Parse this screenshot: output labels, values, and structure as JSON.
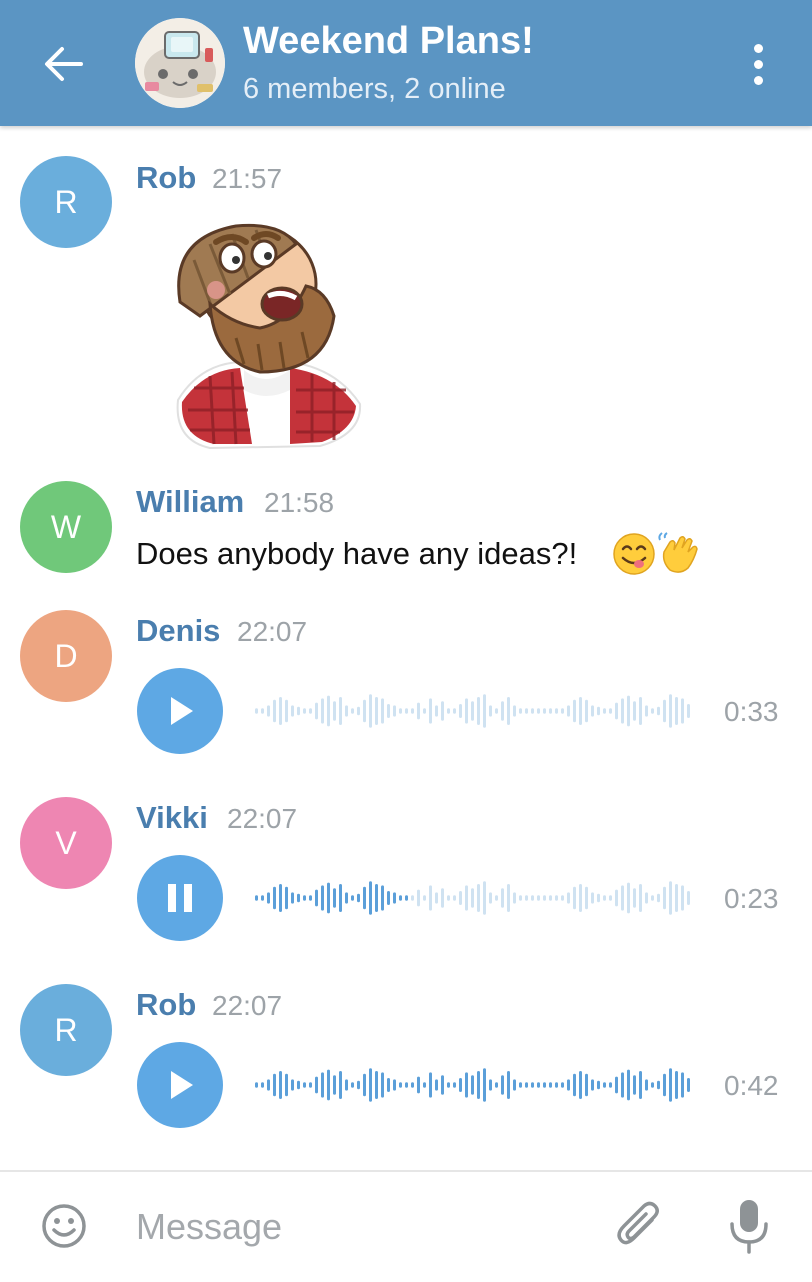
{
  "header": {
    "title": "Weekend Plans!",
    "subtitle": "6 members, 2 online",
    "back_icon": "arrow-left-icon",
    "menu_icon": "more-vertical-icon",
    "bar_color": "#5b95c3"
  },
  "messages": [
    {
      "initial": "R",
      "sender": "Rob",
      "time": "21:57",
      "type": "sticker",
      "avatar_color": "#6aaedc"
    },
    {
      "initial": "W",
      "sender": "William",
      "time": "21:58",
      "type": "text",
      "text": "Does anybody have any ideas?!",
      "emoji": [
        "yum-face",
        "waving-hand"
      ],
      "avatar_color": "#70c87a"
    },
    {
      "initial": "D",
      "sender": "Denis",
      "time": "22:07",
      "type": "voice",
      "state": "play",
      "duration": "0:33",
      "progress": 0.0,
      "avatar_color": "#eda581"
    },
    {
      "initial": "V",
      "sender": "Vikki",
      "time": "22:07",
      "type": "voice",
      "state": "pause",
      "duration": "0:23",
      "progress": 0.35,
      "avatar_color": "#ee86b2"
    },
    {
      "initial": "R",
      "sender": "Rob",
      "time": "22:07",
      "type": "voice",
      "state": "play",
      "duration": "0:42",
      "progress": 1.0,
      "avatar_color": "#6aaedc"
    }
  ],
  "composer": {
    "placeholder": "Message",
    "emoji_icon": "smile-icon",
    "attach_icon": "paperclip-icon",
    "mic_icon": "microphone-icon"
  },
  "colors": {
    "accent": "#5ea8e4",
    "name_color": "#4a7eae",
    "wave_played": "#5b9fd9",
    "wave_unplayed": "#cfe2f1"
  }
}
